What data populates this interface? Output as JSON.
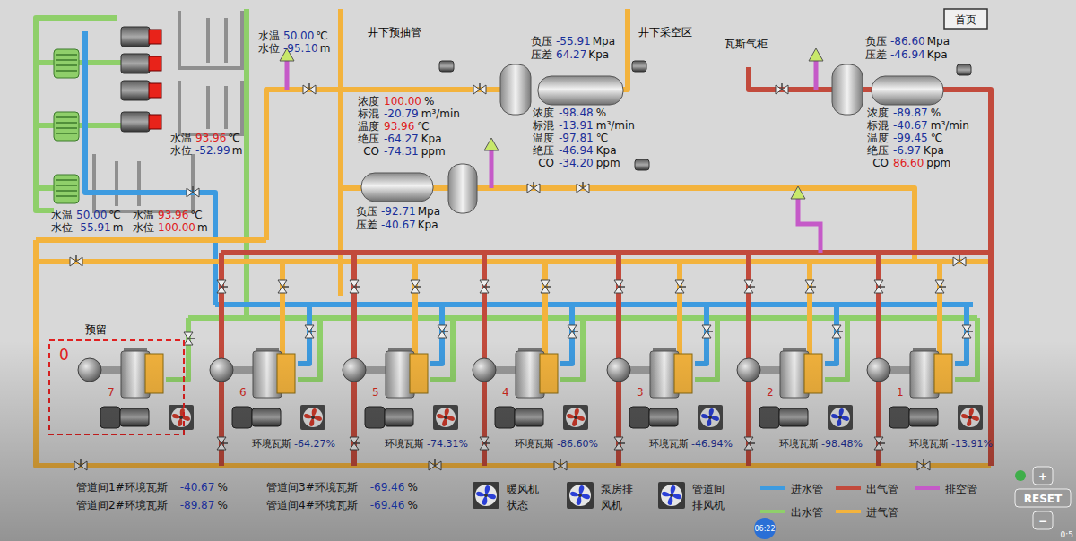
{
  "home_button": {
    "label": "首页"
  },
  "area_labels": [
    {
      "text": "井下预抽管"
    },
    {
      "text": "井下采空区"
    },
    {
      "text": "瓦斯气柜"
    }
  ],
  "tank_readings": [
    {
      "lines": [
        {
          "label": "水温",
          "value": "50.00",
          "unit": "℃",
          "alarm": false
        },
        {
          "label": "水位",
          "value": "-95.10",
          "unit": "m",
          "alarm": false
        }
      ]
    },
    {
      "lines": [
        {
          "label": "水温",
          "value": "93.96",
          "unit": "℃",
          "alarm": true
        },
        {
          "label": "水位",
          "value": "-52.99",
          "unit": "m",
          "alarm": false
        }
      ]
    },
    {
      "lines": [
        {
          "label": "水温",
          "value": "50.00",
          "unit": "℃",
          "alarm": false
        },
        {
          "label": "水位",
          "value": "-55.91",
          "unit": "m",
          "alarm": false
        }
      ]
    },
    {
      "lines": [
        {
          "label": "水温",
          "value": "93.96",
          "unit": "℃",
          "alarm": true
        },
        {
          "label": "水位",
          "value": "100.00",
          "unit": "m",
          "alarm": true
        }
      ]
    }
  ],
  "pump_groups": [
    {
      "lines": [
        {
          "label": "负压",
          "value": "-55.91",
          "unit": "Mpa",
          "alarm": false
        },
        {
          "label": "压差",
          "value": "64.27",
          "unit": "Kpa",
          "alarm": false
        }
      ]
    },
    {
      "lines": [
        {
          "label": "负压",
          "value": "-92.71",
          "unit": "Mpa",
          "alarm": false
        },
        {
          "label": "压差",
          "value": "-40.67",
          "unit": "Kpa",
          "alarm": false
        }
      ]
    },
    {
      "lines": [
        {
          "label": "负压",
          "value": "-86.60",
          "unit": "Mpa",
          "alarm": false
        },
        {
          "label": "压差",
          "value": "-46.94",
          "unit": "Kpa",
          "alarm": false
        }
      ]
    }
  ],
  "sensor_blocks": [
    {
      "lines": [
        {
          "label": "浓度",
          "value": "100.00",
          "unit": "%",
          "alarm": true
        },
        {
          "label": "标混",
          "value": "-20.79",
          "unit": "m³/min",
          "alarm": false
        },
        {
          "label": "温度",
          "value": "93.96",
          "unit": "℃",
          "alarm": true
        },
        {
          "label": "绝压",
          "value": "-64.27",
          "unit": "Kpa",
          "alarm": false
        },
        {
          "label": "CO",
          "value": "-74.31",
          "unit": "ppm",
          "alarm": false
        }
      ]
    },
    {
      "lines": [
        {
          "label": "浓度",
          "value": "-98.48",
          "unit": "%",
          "alarm": false
        },
        {
          "label": "标混",
          "value": "-13.91",
          "unit": "m³/min",
          "alarm": false
        },
        {
          "label": "温度",
          "value": "-97.81",
          "unit": "℃",
          "alarm": false
        },
        {
          "label": "绝压",
          "value": "-46.94",
          "unit": "Kpa",
          "alarm": false
        },
        {
          "label": "CO",
          "value": "-34.20",
          "unit": "ppm",
          "alarm": false
        }
      ]
    },
    {
      "lines": [
        {
          "label": "浓度",
          "value": "-89.87",
          "unit": "%",
          "alarm": false
        },
        {
          "label": "标混",
          "value": "-40.67",
          "unit": "m³/min",
          "alarm": false
        },
        {
          "label": "温度",
          "value": "-99.45",
          "unit": "℃",
          "alarm": false
        },
        {
          "label": "绝压",
          "value": "-6.97",
          "unit": "Kpa",
          "alarm": false
        },
        {
          "label": "CO",
          "value": "86.60",
          "unit": "ppm",
          "alarm": true
        }
      ]
    }
  ],
  "reserved": {
    "label": "预留",
    "badge": "0"
  },
  "units": [
    {
      "number": "7",
      "fan_running": false
    },
    {
      "number": "6",
      "gas_label": "环境瓦斯",
      "gas_value": "-64.27%",
      "fan_running": false
    },
    {
      "number": "5",
      "gas_label": "环境瓦斯",
      "gas_value": "-74.31%",
      "fan_running": false
    },
    {
      "number": "4",
      "gas_label": "环境瓦斯",
      "gas_value": "-86.60%",
      "fan_running": false
    },
    {
      "number": "3",
      "gas_label": "环境瓦斯",
      "gas_value": "-46.94%",
      "fan_running": true
    },
    {
      "number": "2",
      "gas_label": "环境瓦斯",
      "gas_value": "-98.48%",
      "fan_running": true
    },
    {
      "number": "1",
      "gas_label": "环境瓦斯",
      "gas_value": "-13.91%",
      "fan_running": false
    }
  ],
  "pipe_gallery": [
    {
      "label": "管道间1#环境瓦斯",
      "value": "-40.67",
      "unit": "%"
    },
    {
      "label": "管道间2#环境瓦斯",
      "value": "-89.87",
      "unit": "%"
    },
    {
      "label": "管道间3#环境瓦斯",
      "value": "-69.46",
      "unit": "%"
    },
    {
      "label": "管道间4#环境瓦斯",
      "value": "-69.46",
      "unit": "%"
    }
  ],
  "fan_status": [
    {
      "lines": [
        "暖风机",
        "状态"
      ],
      "running": true
    },
    {
      "lines": [
        "泵房排",
        "风机"
      ],
      "running": true
    },
    {
      "lines": [
        "管道间",
        "排风机"
      ],
      "running": true
    }
  ],
  "legend": [
    {
      "label": "进水管",
      "color": "#3d9be0"
    },
    {
      "label": "出气管",
      "color": "#c24a3c"
    },
    {
      "label": "排空管",
      "color": "#c55ac8"
    },
    {
      "label": "出水管",
      "color": "#8fcf6a"
    },
    {
      "label": "进气管",
      "color": "#f3b33d"
    }
  ],
  "controls": [
    {
      "label": "+"
    },
    {
      "label": "RESET"
    },
    {
      "label": "−"
    }
  ],
  "player": {
    "clock": "06:22",
    "time": "0:5"
  }
}
